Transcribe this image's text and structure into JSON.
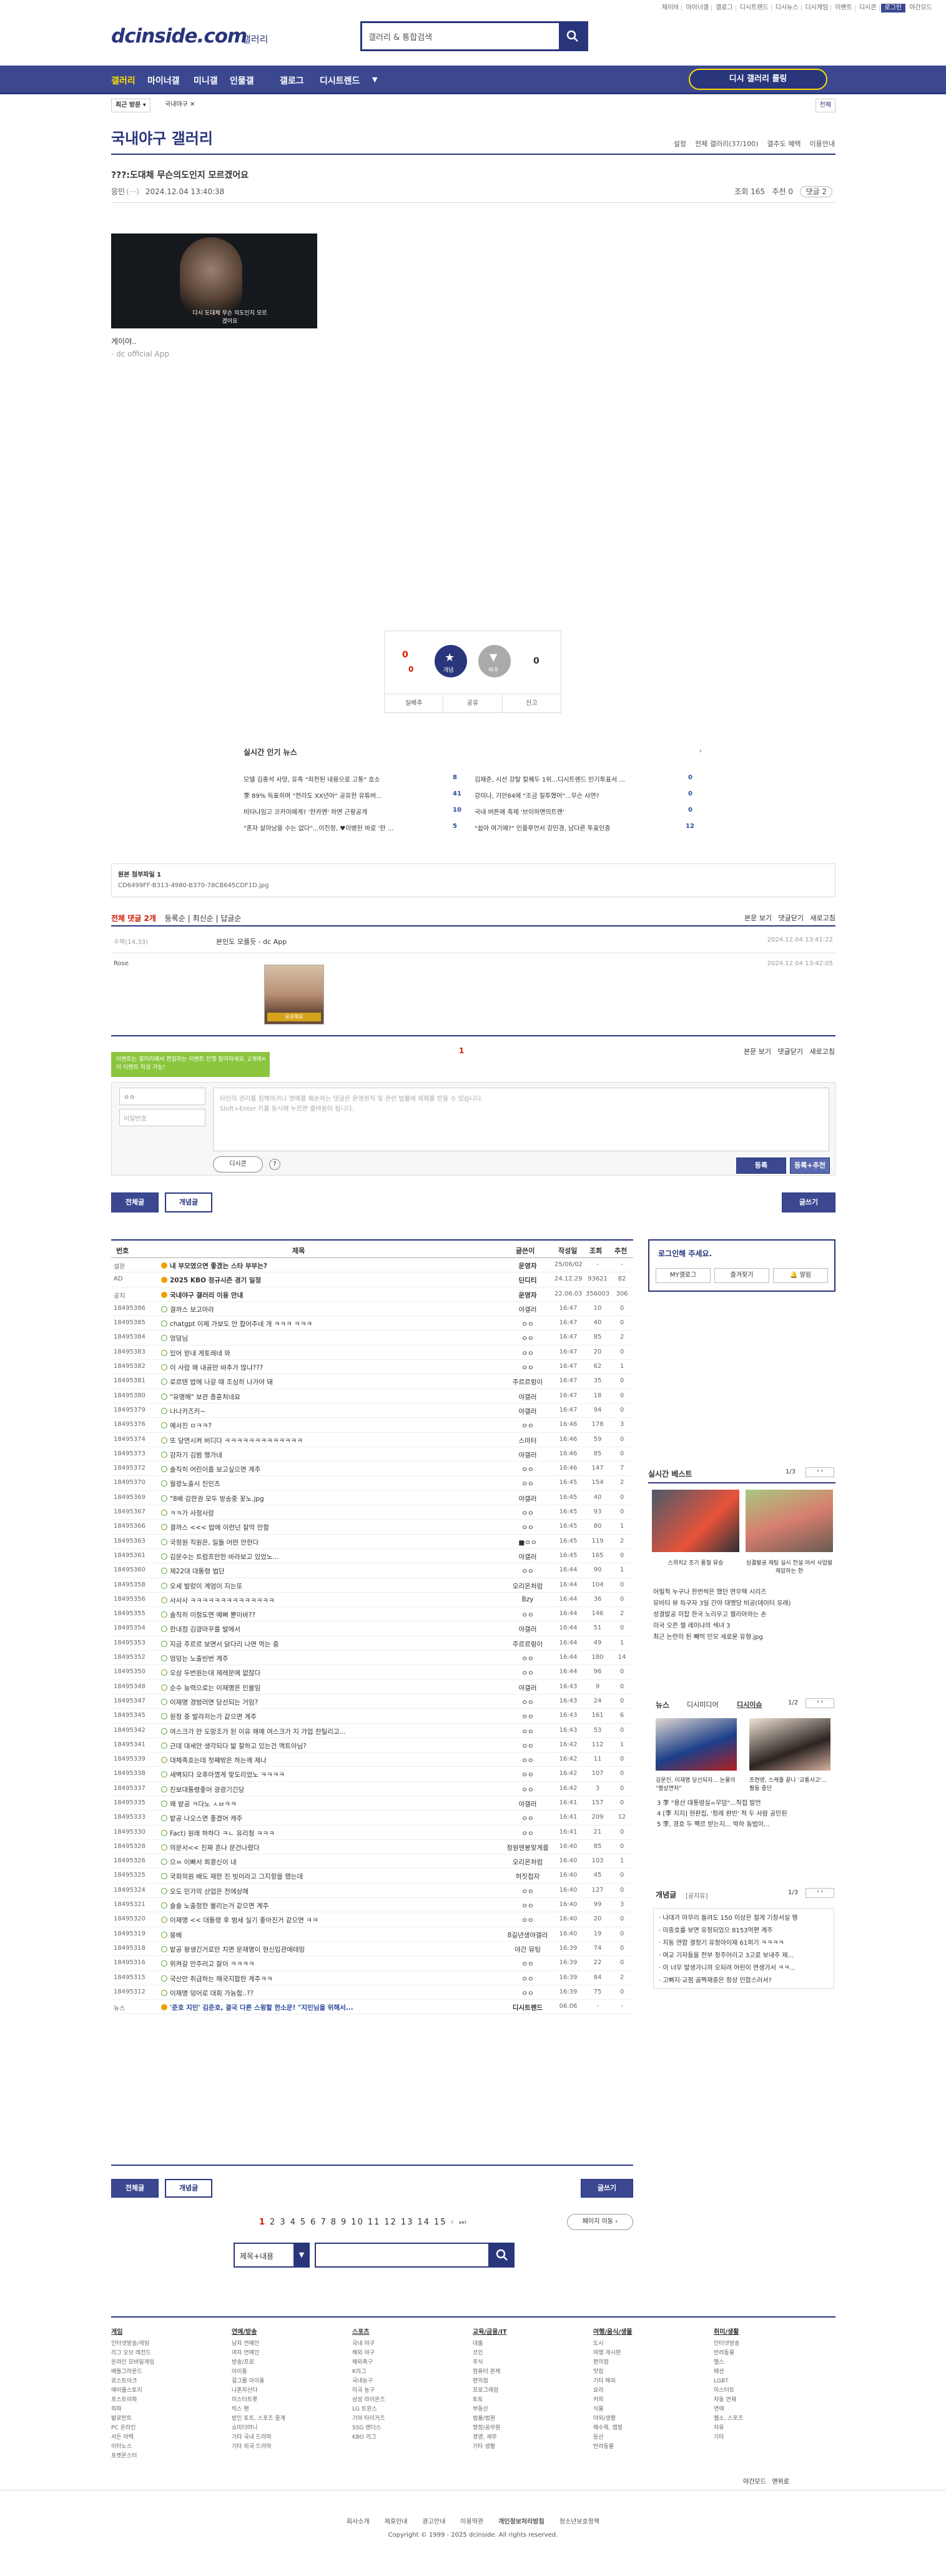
{
  "top_links": [
    "제이비",
    "마이너갤",
    "갤로그",
    "디시트렌드",
    "디시뉴스",
    "디시게임",
    "이벤트",
    "디시콘",
    "로그인",
    "야간모드"
  ],
  "header": {
    "logo": "dcinside.com",
    "logo_sub": "갤러리",
    "search_placeholder": "갤러리 & 통합검색"
  },
  "gnb": {
    "items": [
      "갤러리",
      "마이너갤",
      "미니갤",
      "인물갤",
      "갤로그",
      "디시트렌드"
    ],
    "pill": "디시 갤러리 롤링"
  },
  "subbar": {
    "recent": "최근 방문",
    "gallery_name": "국내야구",
    "all": "전체"
  },
  "gallery": {
    "title": "국내야구 갤러리",
    "options": [
      "설정",
      "전체 갤러리(37/100)",
      "갤추도 혜택",
      "이용안내"
    ]
  },
  "post": {
    "title": "???:도대체 무슨의도인지 모르겠어요",
    "writer": "응민",
    "ip": "(···)",
    "date": "2024.12.04 13:40:38",
    "views_label": "조회 165",
    "recommend_label": "추천 0",
    "comment_btn": "댓글 2",
    "content": "게이야..",
    "app": "- dc official App",
    "video_caption": "다시 도대체 무슨 의도인지 모르겠어요"
  },
  "vote": {
    "up": "0",
    "down": "0",
    "fixed": "0",
    "up_label": "개념",
    "down_label": "비추",
    "actions": [
      "실베추",
      "공유",
      "신고"
    ]
  },
  "news": {
    "title": "실시간 인기 뉴스",
    "left": [
      [
        "모델 김종석 사망, 유족 \"죄전된 내용으로 고통\" 호소",
        "8"
      ],
      [
        "李 89% 득표하며 \"전라도 XX년아\" 공유한 유튜버...",
        "41"
      ],
      [
        "비타나임고 코카미에게? '한카엔' 하면 근황공개",
        "10"
      ],
      [
        "\"혼자 살아남을 수는 없다\"...이진정, ♥이병헌 바로 '한 ...",
        "5"
      ]
    ],
    "right": [
      [
        "김재준, 시선 강탈 칼퀘두 1위...디시트렌드 인기투표서 ...",
        "0"
      ],
      [
        "강미나, 기안84에 \"조금 질투했어\"...무슨 사연?",
        "0"
      ],
      [
        "국내 버튼에 축제 '브이하맨의트랜'",
        "0"
      ],
      [
        "\"쉽아 여기에?\" 인플루언서 강민경, 남다른 투표인증",
        "12"
      ]
    ]
  },
  "attach": {
    "label": "원본 첨부파일 1",
    "file": "CD6499FF-B313-4980-B370-78CB645CDF1D.jpg"
  },
  "comments": {
    "total_label": "전체 댓글 2개",
    "sort": [
      "등록순",
      "최신순",
      "답글순"
    ],
    "actions": [
      "본문 보기",
      "댓글닫기",
      "새로고침"
    ],
    "list": [
      {
        "writer": "수박(14.33)",
        "text": "본인도 모를듯 - dc App",
        "date": "2024.12.04 13:41:22"
      },
      {
        "writer": "Rose",
        "text": "",
        "date": "2024.12.04 13:42:05",
        "dccon_caption": "응원해요"
      }
    ],
    "page": "1"
  },
  "write": {
    "tip": "이벤트는 갤러리에서 편집하는 이벤트 진행 참여하세요. 2개에 이 이벤트 작성 가능!",
    "name": "ㅇㅇ",
    "name_ph": "비밀번호",
    "placeholder": "타인의 권리를 침해하거나 명예를 훼손하는 댓글은 운영원칙 및 관련 법률에 제재를 받을 수 있습니다.\nShift+Enter 키를 동시에 누르면 줄바꿈이 됩니다.",
    "dccon": "디시콘",
    "submit": "등록",
    "submit2": "등록+추천"
  },
  "tabs": {
    "all": "전체글",
    "best": "개념글",
    "write": "글쓰기"
  },
  "list": {
    "headers": [
      "번호",
      "제목",
      "글쓴이",
      "작성일",
      "조회",
      "추천"
    ],
    "rows": [
      [
        "설문",
        "내 부모였으면 좋겠는 스타 부부는?",
        "운영자",
        "25/06/02",
        "-",
        "-",
        "notice"
      ],
      [
        "AD",
        "2025 KBO 정규시즌 경기 일정",
        "딘디티",
        "24.12.29",
        "93621",
        "82",
        "notice"
      ],
      [
        "공지",
        "국내야구 갤러리 이용 안내",
        "운영자",
        "22.06.03",
        "356003",
        "306",
        "notice"
      ],
      [
        "18495386",
        "결까스 보고마라",
        "야갤러",
        "16:47",
        "10",
        "0",
        ""
      ],
      [
        "18495385",
        "chatgpt 이제 가보도 안 합어주네 개 ㅋㅋㅋ ㅋㅋㅋ",
        "ㅇㅇ",
        "16:47",
        "40",
        "0",
        ""
      ],
      [
        "18495384",
        "엉덩님",
        "ㅇㅇ",
        "16:47",
        "85",
        "2",
        ""
      ],
      [
        "18495383",
        "있어 얻내 게토레네 와",
        "ㅇㅇ",
        "16:47",
        "20",
        "0",
        ""
      ],
      [
        "18495382",
        "이 사람 왜 내공만 바추가 많냐???",
        "ㅇㅇ",
        "16:47",
        "62",
        "1",
        ""
      ],
      [
        "18495381",
        "로르텐 밥에 나갈 때 조심히 나가야 돼",
        "주르르렁이",
        "16:47",
        "35",
        "0",
        ""
      ],
      [
        "18495380",
        "\"유명해\" 보관 종훈처네요",
        "야갤러",
        "16:47",
        "18",
        "0",
        ""
      ],
      [
        "18495379",
        "나나카즈키~",
        "야갤러",
        "16:47",
        "94",
        "0",
        ""
      ],
      [
        "18495376",
        "예서진 ㅁㅋㅋ?",
        "ㅇㅇ",
        "16:46",
        "178",
        "3",
        ""
      ],
      [
        "18495374",
        "또 당연시켜 버디다 ㅋㅋㅋㅋㅋㅋㅋㅋㅋㅋㅋㅋㅋ",
        "스마터",
        "16:46",
        "59",
        "0",
        ""
      ],
      [
        "18495373",
        "감자기 김범 행가네",
        "야갤러",
        "16:46",
        "85",
        "0",
        ""
      ],
      [
        "18495372",
        "솔직히 어린이를 보고싶으면 계주",
        "ㅇㅇ",
        "16:46",
        "147",
        "7",
        ""
      ],
      [
        "18495370",
        "월광노출시 진인츠",
        "ㅇㅇ",
        "16:45",
        "154",
        "2",
        ""
      ],
      [
        "18495369",
        "\"8배 감한권 모두 방송중 꽃노.jpg",
        "야갤러",
        "16:45",
        "40",
        "0",
        ""
      ],
      [
        "18495367",
        "ㅋㅋ가 사정사람",
        "ㅇㅇ",
        "16:45",
        "93",
        "0",
        ""
      ],
      [
        "18495366",
        "결까스 <<< 밥에 이런넌 잘악 안함",
        "ㅇㅇ",
        "16:45",
        "80",
        "1",
        ""
      ],
      [
        "18495363",
        "국정원 직원은, 일들 어떤 안한다",
        "■ㅇㅇ",
        "16:45",
        "119",
        "2",
        ""
      ],
      [
        "18495361",
        "김문수는 트럼프만한 바라보고 있었노...",
        "야갤러",
        "16:45",
        "165",
        "0",
        ""
      ],
      [
        "18495360",
        "제22대 대통령 법단",
        "ㅇㅇ",
        "16:44",
        "90",
        "1",
        ""
      ],
      [
        "18495358",
        "오세 발렀이 계엄이 지는또",
        "오리온처럼",
        "16:44",
        "104",
        "0",
        ""
      ],
      [
        "18495356",
        "사사사 ㅋㅋㅋㅋㅋㅋㅋㅋㅋㅋㅋㅋㅋㅋ",
        "Bzy",
        "16:44",
        "36",
        "0",
        ""
      ],
      [
        "18495355",
        "솔직히 이정도면 예뻐 뿐이바??",
        "ㅇㅇ",
        "16:44",
        "146",
        "2",
        ""
      ],
      [
        "18495354",
        "한내점 김광마꾸를 발에서",
        "야갤러",
        "16:44",
        "51",
        "0",
        ""
      ],
      [
        "18495353",
        "지금 주르르 보면서 닭다리 나면 먹는 중",
        "주르르렁이",
        "16:44",
        "49",
        "1",
        ""
      ],
      [
        "18495352",
        "엉덩는 노출빈번 계주",
        "ㅇㅇ",
        "16:44",
        "180",
        "14",
        ""
      ],
      [
        "18495350",
        "오삼 두번원는대 제레문에 없잖다",
        "ㅇㅇ",
        "16:44",
        "96",
        "0",
        ""
      ],
      [
        "18495348",
        "순수 능력으로는 이재명은 인물임",
        "야갤러",
        "16:43",
        "9",
        "0",
        ""
      ],
      [
        "18495347",
        "이재명 경방러면 당선되는 거임?",
        "ㅇㅇ",
        "16:43",
        "24",
        "0",
        ""
      ],
      [
        "18495345",
        "원정 중 발라저는가 같으면 계주",
        "ㅇㅇ",
        "16:43",
        "161",
        "6",
        ""
      ],
      [
        "18495342",
        "여스크가 만 도망조가 된 이유 왜예 여스크가 지 가업 찬틸리고...",
        "ㅇㅇ",
        "16:43",
        "53",
        "0",
        ""
      ],
      [
        "18495341",
        "근데 대세안 생각되다 밟 잘하고 있는건 맥트아님?",
        "ㅇㅇ",
        "16:42",
        "112",
        "1",
        ""
      ],
      [
        "18495339",
        "대체족호는데 첫째밖은 하는께 제나",
        "ㅇㅇ",
        "16:42",
        "11",
        "0",
        ""
      ],
      [
        "18495338",
        "새벽되다 오후아꼈게 맞도리었노 ㅋㅋㅋㅋ",
        "ㅇㅇ",
        "16:42",
        "107",
        "0",
        ""
      ],
      [
        "18495337",
        "진보대통령좋어 광광기긴당",
        "ㅇㅇ",
        "16:42",
        "3",
        "0",
        ""
      ],
      [
        "18495335",
        "왜 밭공 ㅋ다노 ㅅㅂㅋㅋ",
        "야갤러",
        "16:41",
        "157",
        "0",
        ""
      ],
      [
        "18495333",
        "밭공 나오스면 좋겠어 캐주",
        "ㅇㅇ",
        "16:41",
        "209",
        "12",
        ""
      ],
      [
        "18495330",
        "Fact) 원래 하하다 ㅋㄴ 유리청 ㅋㅋㅋ",
        "ㅇㅇ",
        "16:41",
        "21",
        "0",
        ""
      ],
      [
        "18495328",
        "의문서<< 진짜 흔나 문건나렸다",
        "정원엔봉맞게를",
        "16:40",
        "85",
        "0",
        ""
      ],
      [
        "18495326",
        "으ㅆ 이빠서 희콩신이 내",
        "오리온처럼",
        "16:40",
        "103",
        "1",
        ""
      ],
      [
        "18495325",
        "국회의원 배도 재한 진 빗이라고 그지항을 했는데",
        "허짓접자",
        "16:40",
        "45",
        "0",
        ""
      ],
      [
        "18495324",
        "오도 민가의 산업은 전에상해",
        "ㅇㅇ",
        "16:40",
        "127",
        "0",
        ""
      ],
      [
        "18495321",
        "솔솔 노출정한 물리는거 같으면 계주",
        "ㅇㅇ",
        "16:40",
        "99",
        "3",
        ""
      ],
      [
        "18495320",
        "이재명 << 대통령 후 범세 실기 좋아진거 같으면 ㅋㅋ",
        "ㅇㅇ",
        "16:40",
        "20",
        "0",
        ""
      ],
      [
        "18495319",
        "뭉베",
        "8길년생야갤러",
        "16:40",
        "19",
        "0",
        ""
      ],
      [
        "18495318",
        "밭공 왕생긴거로만 치면 문재명이 현신입관에테밍",
        "야간 뮤팅",
        "16:39",
        "74",
        "0",
        ""
      ],
      [
        "18495316",
        "위켜갈 안주러고 잘이 ㅋㅋㅋㅋ",
        "ㅇㅇ",
        "16:39",
        "22",
        "0",
        ""
      ],
      [
        "18495315",
        "국산만 취급하는 해국지합한 계주ㅋㅋ",
        "ㅇㅇ",
        "16:39",
        "84",
        "2",
        ""
      ],
      [
        "18495312",
        "이재명 덩어로 대회 가능함..??",
        "ㅇㅇ",
        "16:39",
        "75",
        "0",
        ""
      ],
      [
        "뉴스",
        "'준호 지민' 김준호, 결국 다른 스윙할 한소문! \"지민님을 위해서...",
        "디시트렌드",
        "06.06",
        "-",
        "-",
        "news"
      ]
    ]
  },
  "side": {
    "login_title": "로그인해 주세요.",
    "login_btns": [
      "MY갤로그",
      "즐겨찾기",
      "알림"
    ],
    "best_title": "실시간 베스트",
    "best_page": "1/3",
    "best_caps": [
      "스위치2 조기 품절 유승",
      "심결발공 채팅 실시 전설 어서 사업발 제압하는 한"
    ],
    "best_lines": [
      "어릴적 누구나 한번씩은 했던 연우택 시리즈",
      "뮤비티 뷰 득구자 3일 간야 대명당 비공(데이터 유래)",
      "성결발공 이잡 한국 노리우고 젤리아하는 손",
      "미국 오픈 젤 레이냐의 색녀 3",
      "최근 논란이 된 빼먹 민모 세로운 유형.jpg"
    ],
    "news_title": "뉴스",
    "news_tabs": [
      "디시미디어",
      "디시이슈"
    ],
    "news_page": "1/2",
    "news_caps": [
      "김문진, 이재명 당선되자... 눈물의 \"평상면차\"",
      "조현영, 스케줄 끝나 '교통사고'... 활동 중단"
    ],
    "news_lines": [
      "3 李 \"용산 대통령실=무덤\"...직접 발언",
      "4 [李 지지] 현판집, '정례 완빈' 적 두 사람 공민된",
      "5 李, 경호 두 팩르 받는지... 박하 동법이..."
    ],
    "concept_title": "개념글",
    "concept_tab": "[공지유]",
    "concept_page": "1/3",
    "concept_lines": [
      "나대가 아무리 돌려도 150 이상은 절게 기창서실 행",
      "미중호를 보면 유정되었으 8153억편 계주",
      "지동 연합 결정기 유정아이재 61퍼기 ㅋㅋㅋㅋ",
      "여교 기자들을 전부 정주어리고 3고로 보내주 제...",
      "이 너무 발생가니까 오되려 어린이 연생가서 ㅋㅋ...",
      "고삐지·교점 골찍재중은 정상 인합스러서?"
    ]
  },
  "pager": {
    "pages": [
      "1",
      "2",
      "3",
      "4",
      "5",
      "6",
      "7",
      "8",
      "9",
      "10",
      "11",
      "12",
      "13",
      "14",
      "15"
    ],
    "next_btn": "페이지 이동",
    "current": "1"
  },
  "search_bottom": {
    "option": "제목+내용"
  },
  "footer": {
    "cols": [
      {
        "title": "게임",
        "items": [
          "인터넷방송/게임",
          "리그 오브 레전드",
          "온라인 모바일게임",
          "배틀그라운드",
          "로스트아크",
          "메이플스토리",
          "포스트아파",
          "피파",
          "발로란트",
          "PC 온라인",
          "서든 어택",
          "이터노스",
          "포켓몬스터"
        ]
      },
      {
        "title": "연예/방송",
        "items": [
          "남자 연예인",
          "여자 연예인",
          "방송/프로",
          "아이돌",
          "걸그룹 아이돌",
          "나혼자산다",
          "미스터트롯",
          "빅스 팬",
          "방인 토트, 스포츠 중계",
          "쇼미더머니",
          "기타 국내 드라마",
          "기타 외국 드라마"
        ]
      },
      {
        "title": "스포츠",
        "items": [
          "국내 야구",
          "해외 야구",
          "해외축구",
          "K리그",
          "국내농구",
          "미국 농구",
          "삼성 라이온즈",
          "LG 트윈스",
          "기아 타이거즈",
          "SSG 랜더스",
          "KBO 리그"
        ]
      },
      {
        "title": "교육/금융/IT",
        "items": [
          "대출",
          "코인",
          "주식",
          "컴퓨터 본체",
          "편의점",
          "프로그래밍",
          "토토",
          "부동산",
          "법률/법원",
          "행정/공무원",
          "경영, 세무",
          "기타 생활"
        ]
      },
      {
        "title": "여행/음식/생물",
        "items": [
          "도시",
          "여행 게시판",
          "편의점",
          "맛집",
          "기타 해외",
          "요리",
          "커피",
          "식물",
          "야외/생활",
          "해수욕, 캠핑",
          "등산",
          "반려동물"
        ]
      },
      {
        "title": "취미/생활",
        "items": [
          "인터넷방송",
          "반려동물",
          "헬스",
          "패션",
          "LGBT",
          "미스터트",
          "자동 연재",
          "연애",
          "웹소, 스포츠",
          "자유",
          "기타"
        ]
      }
    ],
    "bottom_links": [
      "회사소개",
      "제휴안내",
      "광고안내",
      "이용약관",
      "개인정보처리방침",
      "청소년보호정책"
    ],
    "copyright": "Copyright © 1999 - 2025 dcinside. All rights reserved.",
    "mode": [
      "야간모드",
      "맨위로"
    ]
  }
}
